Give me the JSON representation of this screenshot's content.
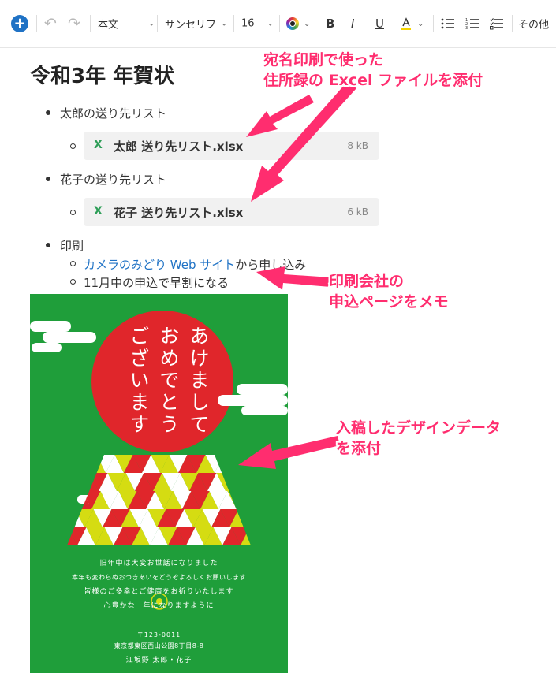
{
  "toolbar": {
    "style_select": "本文",
    "font_select": "サンセリフ",
    "size_select": "16",
    "bold_label": "B",
    "italic_label": "I",
    "underline_label": "U",
    "more_label": "その他"
  },
  "document": {
    "title": "令和3年 年賀状",
    "items": [
      {
        "label": "太郎の送り先リスト",
        "file": {
          "name": "太郎 送り先リスト.xlsx",
          "size": "8 kB"
        }
      },
      {
        "label": "花子の送り先リスト",
        "file": {
          "name": "花子 送り先リスト.xlsx",
          "size": "6 kB"
        }
      },
      {
        "label": "印刷",
        "sub": [
          {
            "link": "カメラのみどり Web サイト",
            "text": "から申し込み"
          },
          {
            "text": "11月中の申込で早割になる"
          }
        ]
      }
    ]
  },
  "annotations": {
    "file_note": [
      "宛名印刷で使った",
      "住所録の Excel ファイルを添付"
    ],
    "web_note": [
      "印刷会社の",
      "申込ページをメモ"
    ],
    "design_note": [
      "入稿したデザインデータ",
      "を添付"
    ]
  },
  "card": {
    "greeting_columns": [
      "あけまして",
      "おめでとう",
      "ございます"
    ],
    "message": [
      "旧年中は大変お世話になりました",
      "本年も変わらぬおつきあいをどうぞよろしくお願いします",
      "皆様のご多幸とご健康をお祈りいたします",
      "心豊かな一年になりますように"
    ],
    "postal": "〒123-0011",
    "address": "東京都東区西山公園8丁目8-8",
    "names": "江坂野 太郎・花子",
    "colors": {
      "background": "#1f9e3a",
      "sun": "#e0262b",
      "yellow": "#d5dc12"
    }
  }
}
